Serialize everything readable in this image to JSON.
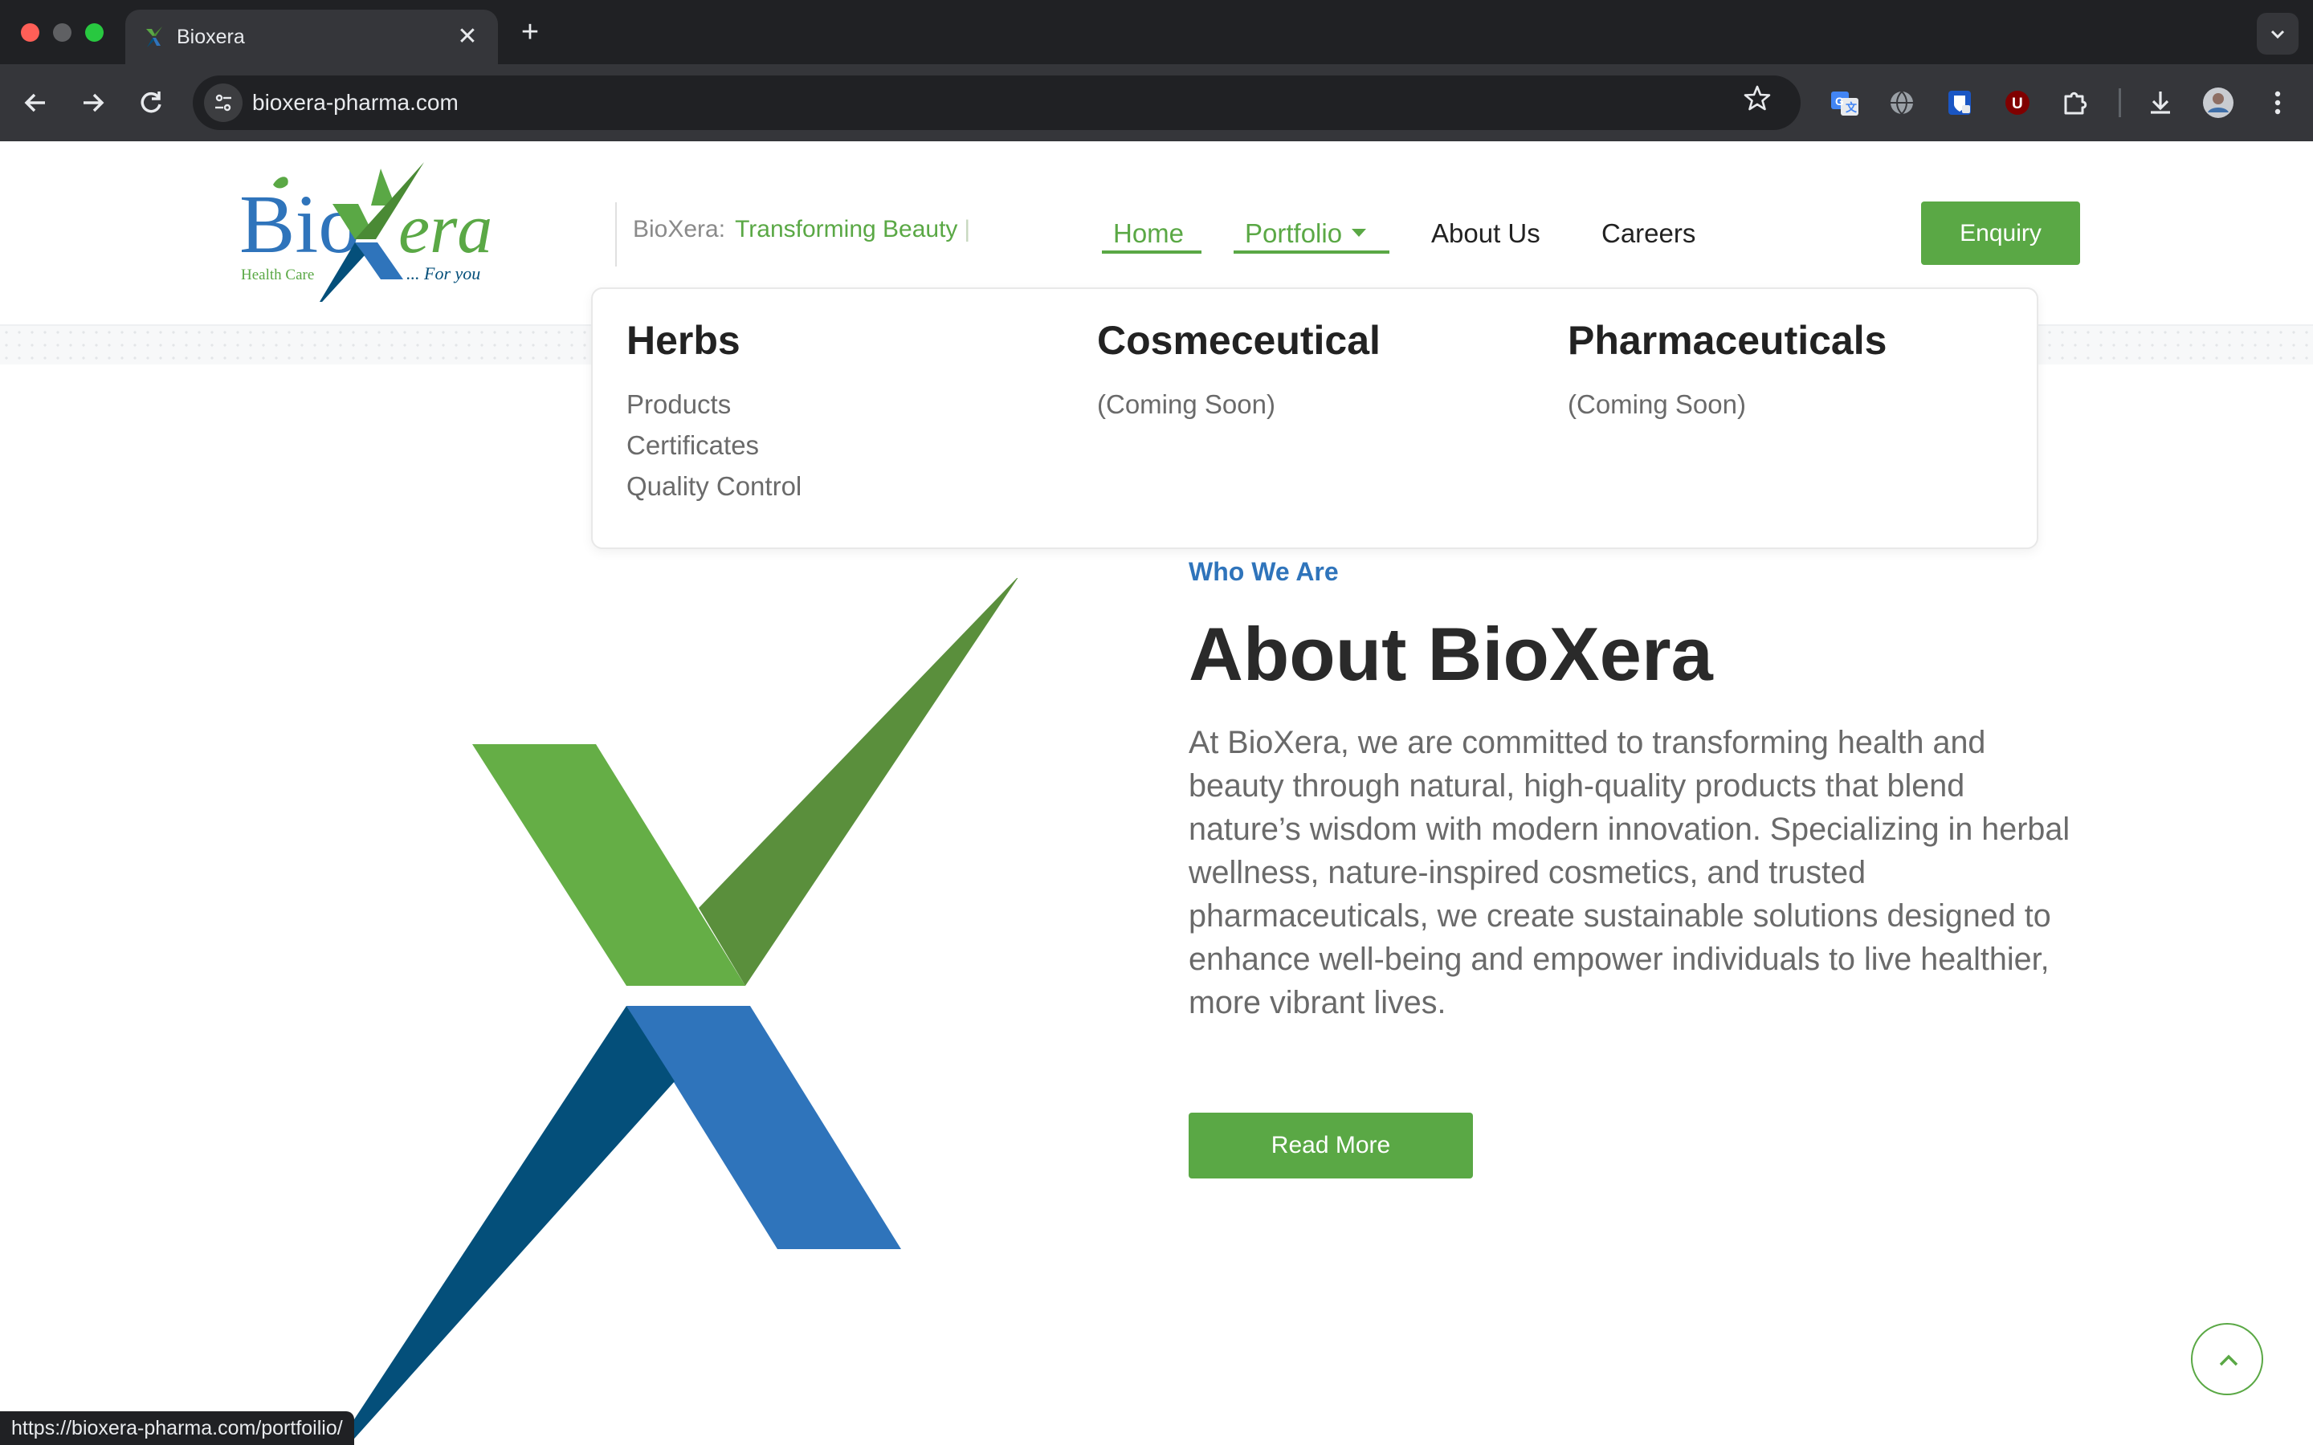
{
  "browser": {
    "tab_title": "Bioxera",
    "tab_close": "✕",
    "new_tab": "+",
    "address": "bioxera-pharma.com",
    "status_url": "https://bioxera-pharma.com/portfoilio/",
    "icons": {
      "back": "arrow-left-icon",
      "forward": "arrow-right-icon",
      "reload": "reload-icon",
      "bookmark": "star-icon",
      "extensions": [
        "translate-icon",
        "globe-icon",
        "shield-icon",
        "ublock-icon",
        "puzzle-icon"
      ],
      "download": "download-icon",
      "profile": "avatar",
      "menu": "more-vertical-icon"
    }
  },
  "header": {
    "logo_text": "BioXera",
    "logo_sub_left": "Health Care",
    "logo_sub_right": "... For you",
    "tagline_brand": "BioXera:",
    "tagline_accent": "Transforming Beauty",
    "tagline_caret": "|",
    "nav": {
      "home": "Home",
      "portfolio": "Portfolio",
      "about": "About Us",
      "careers": "Careers"
    },
    "enquiry": "Enquiry"
  },
  "mega_menu": {
    "columns": [
      {
        "heading": "Herbs",
        "items": [
          "Products",
          "Certificates",
          "Quality Control"
        ]
      },
      {
        "heading": "Cosmeceutical",
        "items": [
          "(Coming Soon)"
        ]
      },
      {
        "heading": "Pharmaceuticals",
        "items": [
          "(Coming Soon)"
        ]
      }
    ]
  },
  "about": {
    "eyebrow": "Who We Are",
    "title": "About BioXera",
    "body": "At BioXera, we are committed to transforming health and beauty through natural, high-quality products that blend nature’s wisdom with modern innovation. Specializing in herbal wellness, nature-inspired cosmetics, and trusted pharmaceuticals, we create sustainable solutions designed to enhance well-being and empower individuals to live healthier, more vibrant lives.",
    "read_more": "Read More"
  },
  "colors": {
    "brand_green": "#5aa845",
    "dark_green": "#5a8f3c",
    "brand_blue": "#2f74bb",
    "navy": "#044f7a"
  }
}
